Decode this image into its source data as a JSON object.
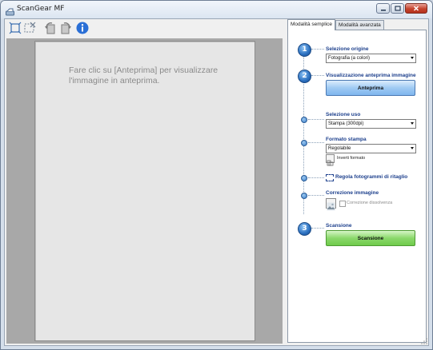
{
  "window": {
    "title": "ScanGear MF"
  },
  "toolbar": {
    "icons": [
      "autocrop-icon",
      "remove-crop-icon",
      "rotate-left-icon",
      "rotate-right-icon",
      "info-icon"
    ]
  },
  "preview": {
    "message": "Fare clic su [Anteprima] per visualizzare l'immagine in anteprima."
  },
  "tabs": [
    {
      "label": "Modalità semplice",
      "active": true
    },
    {
      "label": "Modalità avanzata",
      "active": false
    }
  ],
  "steps": {
    "source": {
      "number": "1",
      "label": "Selezione origine",
      "value": "Fotografia (a colori)"
    },
    "preview": {
      "number": "2",
      "label": "Visualizzazione anteprima immagine",
      "button": "Anteprima"
    },
    "usage": {
      "label": "Selezione uso",
      "value": "Stampa (300dpi)"
    },
    "output_size": {
      "label": "Formato stampa",
      "value": "Regolabile",
      "invert_label": "Inverti formato"
    },
    "crop": {
      "label": "Regola fotogrammi di ritaglio"
    },
    "correction": {
      "label": "Correzione immagine",
      "descreen_label": "Correzione dissolvenza",
      "descreen_checked": false
    },
    "scan": {
      "number": "3",
      "label": "Scansione",
      "button": "Scansione"
    }
  },
  "colors": {
    "accent_blue": "#1c3f8c",
    "preview_button": "#9fcaf3",
    "scan_button": "#8bd86b",
    "close_button": "#c4432d"
  }
}
